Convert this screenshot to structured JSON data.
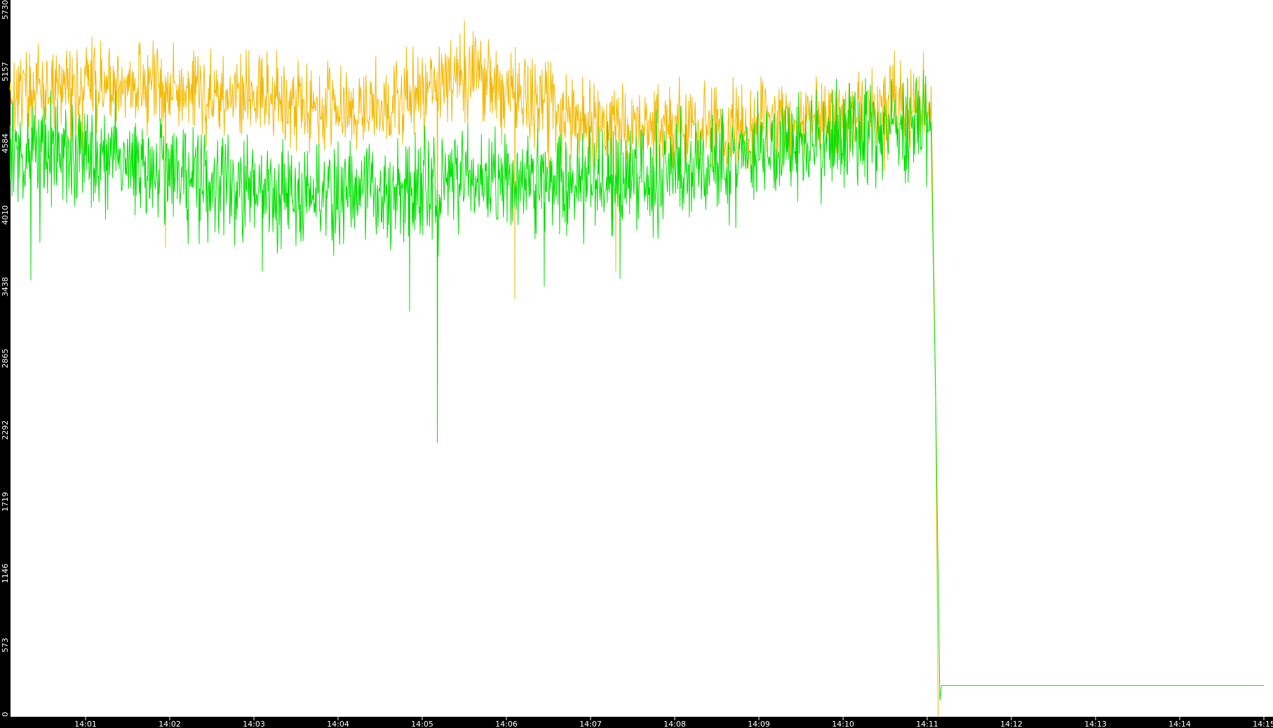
{
  "chart_data": {
    "type": "line",
    "title": "",
    "xlabel": "",
    "ylabel": "",
    "y_ticks": [
      "0",
      "573",
      "1146",
      "1719",
      "2292",
      "2865",
      "3438",
      "4010",
      "4584",
      "5157",
      "5730"
    ],
    "ylim": [
      0,
      5730
    ],
    "x_ticks": [
      "14:01",
      "14:02",
      "14:03",
      "14:04",
      "14:05",
      "14:06",
      "14:07",
      "14:08",
      "14:09",
      "14:10",
      "14:11",
      "14:12",
      "14:13",
      "14:14",
      "14:15"
    ],
    "x_range_minutes": [
      0.1,
      15.0
    ],
    "grid": false,
    "legend": "none",
    "colors": {
      "background": "#ffffff",
      "frame": "#000000",
      "axis_text": "#ffffff"
    },
    "series": [
      {
        "color": "#f5b800",
        "base": [
          [
            0.1,
            5000
          ],
          [
            1.5,
            5050
          ],
          [
            3.0,
            4950
          ],
          [
            4.5,
            4850
          ],
          [
            5.5,
            5150
          ],
          [
            7.0,
            4750
          ],
          [
            8.5,
            4700
          ],
          [
            10.0,
            4800
          ],
          [
            11.05,
            4900
          ]
        ],
        "noise": 260,
        "spikes": [
          [
            1.95,
            3750
          ],
          [
            5.18,
            2600
          ],
          [
            6.1,
            3340
          ],
          [
            7.3,
            3560
          ]
        ],
        "dropoff": [
          [
            11.1,
            2550
          ],
          [
            11.13,
            0
          ]
        ],
        "tail": null
      },
      {
        "color": "#00e000",
        "base": [
          [
            0.1,
            4550
          ],
          [
            1.5,
            4450
          ],
          [
            3.0,
            4200
          ],
          [
            4.5,
            4150
          ],
          [
            5.5,
            4300
          ],
          [
            7.0,
            4250
          ],
          [
            8.5,
            4400
          ],
          [
            10.0,
            4650
          ],
          [
            11.05,
            4750
          ]
        ],
        "noise": 320,
        "spikes": [
          [
            0.35,
            3490
          ],
          [
            3.1,
            3560
          ],
          [
            4.85,
            3240
          ],
          [
            5.18,
            2190
          ],
          [
            6.45,
            3440
          ],
          [
            7.35,
            3500
          ]
        ],
        "dropoff": [
          [
            11.1,
            2550
          ],
          [
            11.15,
            130
          ],
          [
            11.17,
            250
          ]
        ],
        "tail": 250
      }
    ]
  }
}
